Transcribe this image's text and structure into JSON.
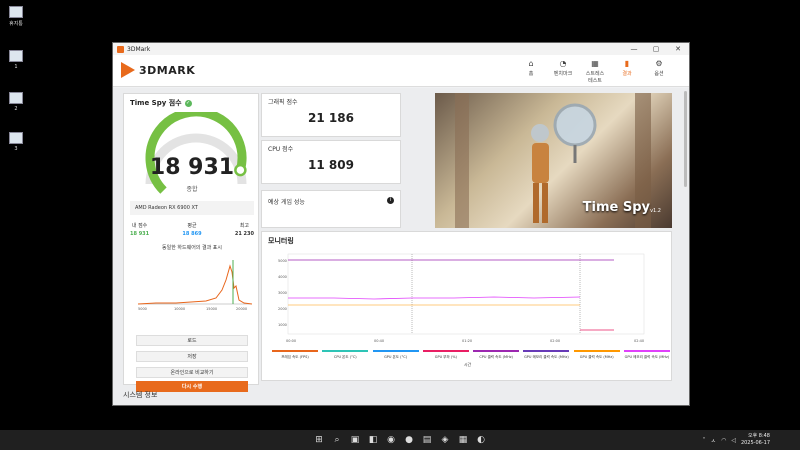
{
  "desktop": {
    "icons": [
      {
        "label": "휴지통",
        "top": 6
      },
      {
        "label": "1",
        "top": 50
      },
      {
        "label": "2",
        "top": 92
      },
      {
        "label": "3",
        "top": 132
      }
    ]
  },
  "window": {
    "title": "3DMark",
    "controls": {
      "minimize": "—",
      "maximize": "▢",
      "close": "✕"
    }
  },
  "header": {
    "logo": "3DMARK",
    "nav": [
      {
        "icon": "⌂",
        "label": "홈",
        "active": false
      },
      {
        "icon": "◔",
        "label": "벤치마크",
        "active": false
      },
      {
        "icon": "▦",
        "label": "스트레스 테스트",
        "active": false
      },
      {
        "icon": "▮",
        "label": "결과",
        "active": true
      },
      {
        "icon": "⚙",
        "label": "옵션",
        "active": false
      }
    ]
  },
  "score_card": {
    "title": "Time Spy 점수",
    "score": "18 931",
    "score_label": "종합",
    "gpu": "AMD Radeon RX 6900 XT",
    "stats": [
      {
        "label": "내 점수",
        "value": "18 931",
        "color": "#4caf50"
      },
      {
        "label": "평균",
        "value": "18 869",
        "color": "#2196f3"
      },
      {
        "label": "최고",
        "value": "21 230",
        "color": "#333333"
      }
    ],
    "distribution_label": "동일한 하드웨어의 결과 표시",
    "buttons": {
      "load": "로드",
      "save": "저장",
      "compare": "온라인으로 비교하기",
      "run_again": "다시 수행"
    },
    "gauge_fraction": 0.89
  },
  "graphics_score": {
    "title": "그래픽 점수",
    "value": "21 186"
  },
  "cpu_score": {
    "title": "CPU 점수",
    "value": "11 809"
  },
  "game_perf": {
    "title": "예상 게임 성능",
    "info_icon": "i"
  },
  "hero": {
    "title": "Time Spy",
    "version": "v1.2"
  },
  "monitoring": {
    "title": "모니터링",
    "legend": [
      {
        "label": "프레임 속도 (FPS)",
        "color": "#e8661c"
      },
      {
        "label": "CPU 온도 (°C)",
        "color": "#2ec4b6"
      },
      {
        "label": "GPU 온도 (°C)",
        "color": "#2196f3"
      },
      {
        "label": "GPU 부하 (%)",
        "color": "#e91e63"
      },
      {
        "label": "CPU 클럭 속도 (MHz)",
        "color": "#9c27b0"
      },
      {
        "label": "GPU 메모리 클럭 속도 (MHz)",
        "color": "#673ab7"
      },
      {
        "label": "GPU 클럭 속도 (MHz)",
        "color": "#ff9800"
      },
      {
        "label": "GPU 메모리 클럭 속도 (MHz)",
        "color": "#e040fb"
      }
    ],
    "time_label": "시간",
    "x_ticks": [
      "00:00",
      "00:40",
      "01:20",
      "02:00",
      "02:40"
    ],
    "y_ticks": [
      "5000",
      "4000",
      "3000",
      "2000",
      "1000"
    ]
  },
  "sysinfo": {
    "title": "시스템 정보"
  },
  "taskbar": {
    "icons": [
      "⊞",
      "⌕",
      "▣",
      "◧",
      "◉",
      "●",
      "▤",
      "◈",
      "▦",
      "◐"
    ],
    "tray": {
      "lang": "ㅅ",
      "time": "오후 8:48",
      "date": "2025-06-17"
    }
  }
}
